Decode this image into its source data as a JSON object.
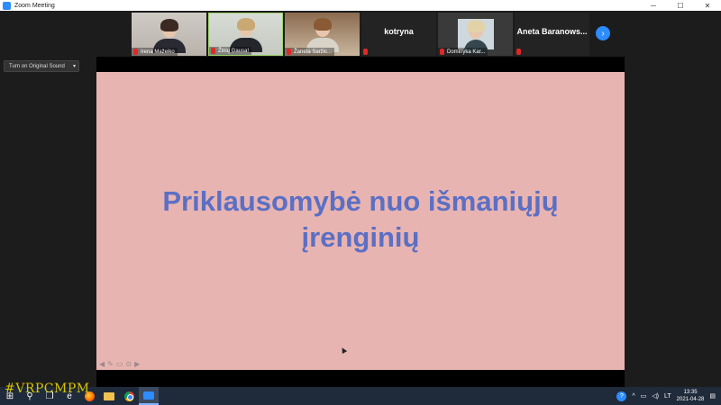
{
  "window": {
    "title": "Zoom Meeting",
    "controls": [
      "─",
      "☐",
      "✕"
    ]
  },
  "participants": [
    {
      "name": "Irena Mažeiko",
      "type": "video"
    },
    {
      "name": "Žinių Gausa!",
      "type": "video"
    },
    {
      "name": "Žaneta Saržic...",
      "type": "video"
    },
    {
      "name": "kotryna",
      "type": "name"
    },
    {
      "name": "Dominyka Kar...",
      "type": "video"
    },
    {
      "name": "Aneta  Baranows...",
      "type": "name"
    }
  ],
  "sound_button": {
    "label": "Turn on Original Sound",
    "caret": "▾"
  },
  "slide": {
    "title": "Priklausomybė nuo išmaniųjų įrenginių",
    "background": "#e8b4b1",
    "title_color": "#5b6fc4"
  },
  "watermark": "#VRPCMPM",
  "taskbar": {
    "language": "LT",
    "time": "13:35",
    "date": "2021-04-28",
    "help_glyph": "?",
    "chevron": "^",
    "network_glyph": "▭",
    "volume_glyph": "◁)"
  },
  "colors": {
    "zoom_blue": "#2d8cff",
    "mic_muted": "#e02828",
    "taskbar": "#1f2a3a"
  }
}
